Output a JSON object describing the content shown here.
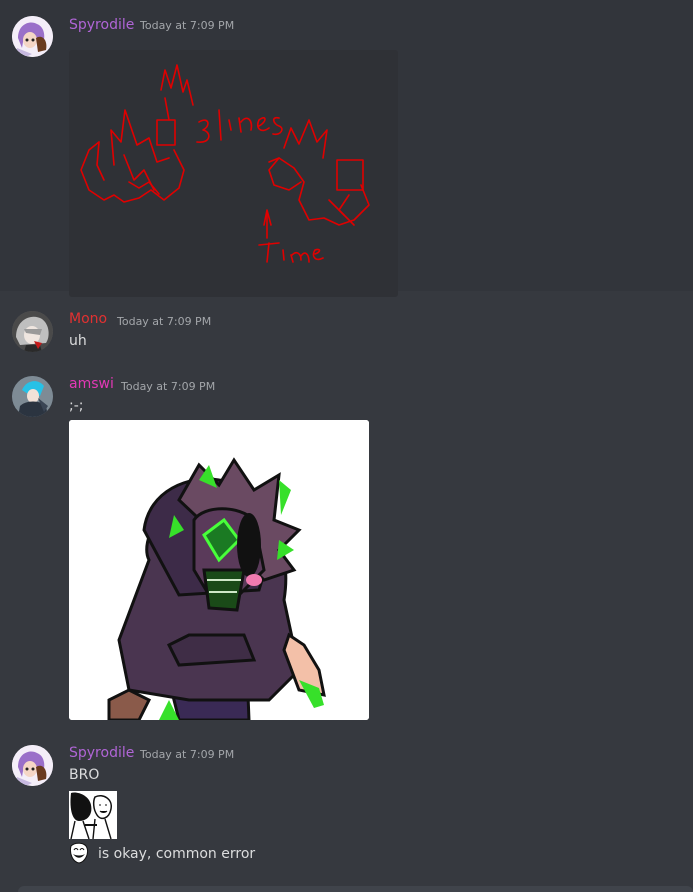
{
  "messages": [
    {
      "username": "Spyrodile",
      "username_color": "#b065d6",
      "timestamp": "Today at 7:09 PM",
      "attachment_drawing": {
        "text_top": "3 lines",
        "text_bottom": "Time",
        "text_marker": "1",
        "ink_color": "#e00000"
      }
    },
    {
      "username": "Mono",
      "username_color": "#e23131",
      "timestamp": "Today at 7:09 PM",
      "text": "uh"
    },
    {
      "username": "amswi",
      "username_color": "#e338b6",
      "timestamp": "Today at 7:09 PM",
      "text": ";-;"
    },
    {
      "username": "Spyrodile",
      "username_color": "#b065d6",
      "timestamp": "Today at 7:09 PM",
      "text": "BRO",
      "text2": "is okay, common error"
    }
  ],
  "colors": {
    "background": "#36393f",
    "highlight": "#32353b",
    "text": "#dcddde",
    "timestamp": "#a3a6aa"
  },
  "icons": [
    "avatar-purple-hair",
    "avatar-gray-hair",
    "avatar-blue-hair",
    "trollface-emoji"
  ]
}
